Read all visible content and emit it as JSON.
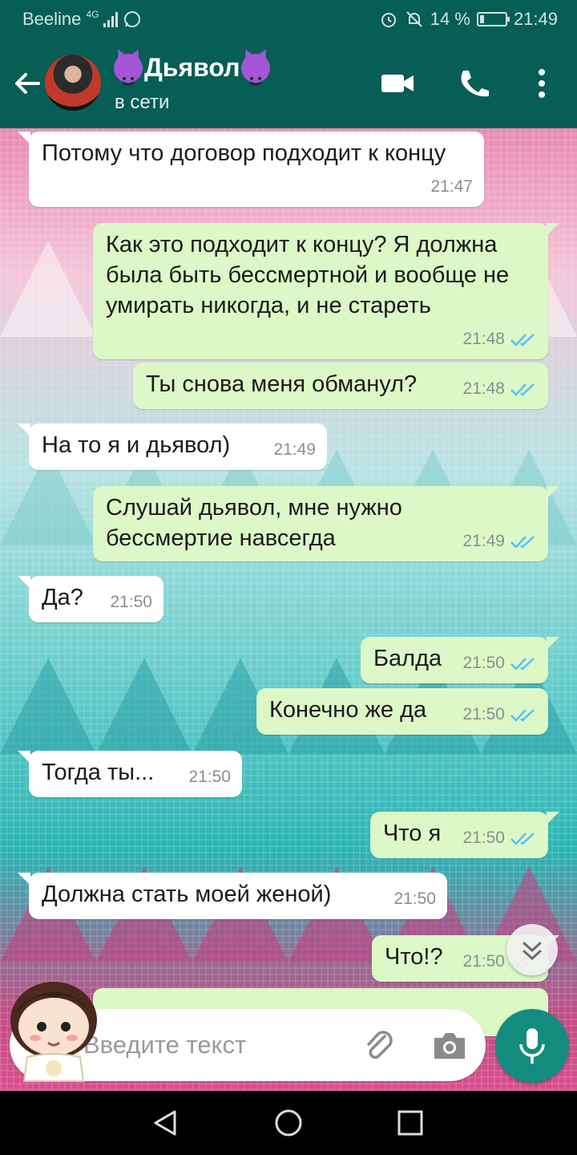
{
  "status_bar": {
    "carrier": "Beeline",
    "network": "4G",
    "battery": "14 %",
    "time": "21:49"
  },
  "header": {
    "contact_name": "Дьявол",
    "status": "в сети"
  },
  "messages": [
    {
      "dir": "in",
      "text": "Потому что договор подходит к концу",
      "time": "21:47"
    },
    {
      "dir": "out",
      "text": "Как это подходит к концу? Я должна была быть бессмертной и вообще не умирать никогда, и не стареть",
      "time": "21:48"
    },
    {
      "dir": "out",
      "text": "Ты снова меня обманул?",
      "time": "21:48"
    },
    {
      "dir": "in",
      "text": "На то я и дьявол)",
      "time": "21:49"
    },
    {
      "dir": "out",
      "text": "Слушай дьявол, мне нужно бессмертие навсегда",
      "time": "21:49"
    },
    {
      "dir": "in",
      "text": "Да?",
      "time": "21:50"
    },
    {
      "dir": "out",
      "text": "Балда",
      "time": "21:50"
    },
    {
      "dir": "out",
      "text": "Конечно же да",
      "time": "21:50"
    },
    {
      "dir": "in",
      "text": "Тогда ты...",
      "time": "21:50"
    },
    {
      "dir": "out",
      "text": "Что я",
      "time": "21:50"
    },
    {
      "dir": "in",
      "text": "Должна стать моей женой)",
      "time": "21:50"
    },
    {
      "dir": "out",
      "text": "Что!?",
      "time": "21:50"
    }
  ],
  "composer": {
    "placeholder": "Введите текст"
  },
  "icons": [
    "back-arrow-icon",
    "video-call-icon",
    "phone-icon",
    "more-icon",
    "attach-icon",
    "camera-icon",
    "mic-icon",
    "scroll-down-icon",
    "nav-back-icon",
    "nav-home-icon",
    "nav-recents-icon"
  ],
  "colors": {
    "header": "#075e54",
    "outgoing_bubble": "#dcf8c6",
    "incoming_bubble": "#ffffff",
    "read_ticks": "#4fc3f7",
    "mic_button": "#128c7e"
  }
}
